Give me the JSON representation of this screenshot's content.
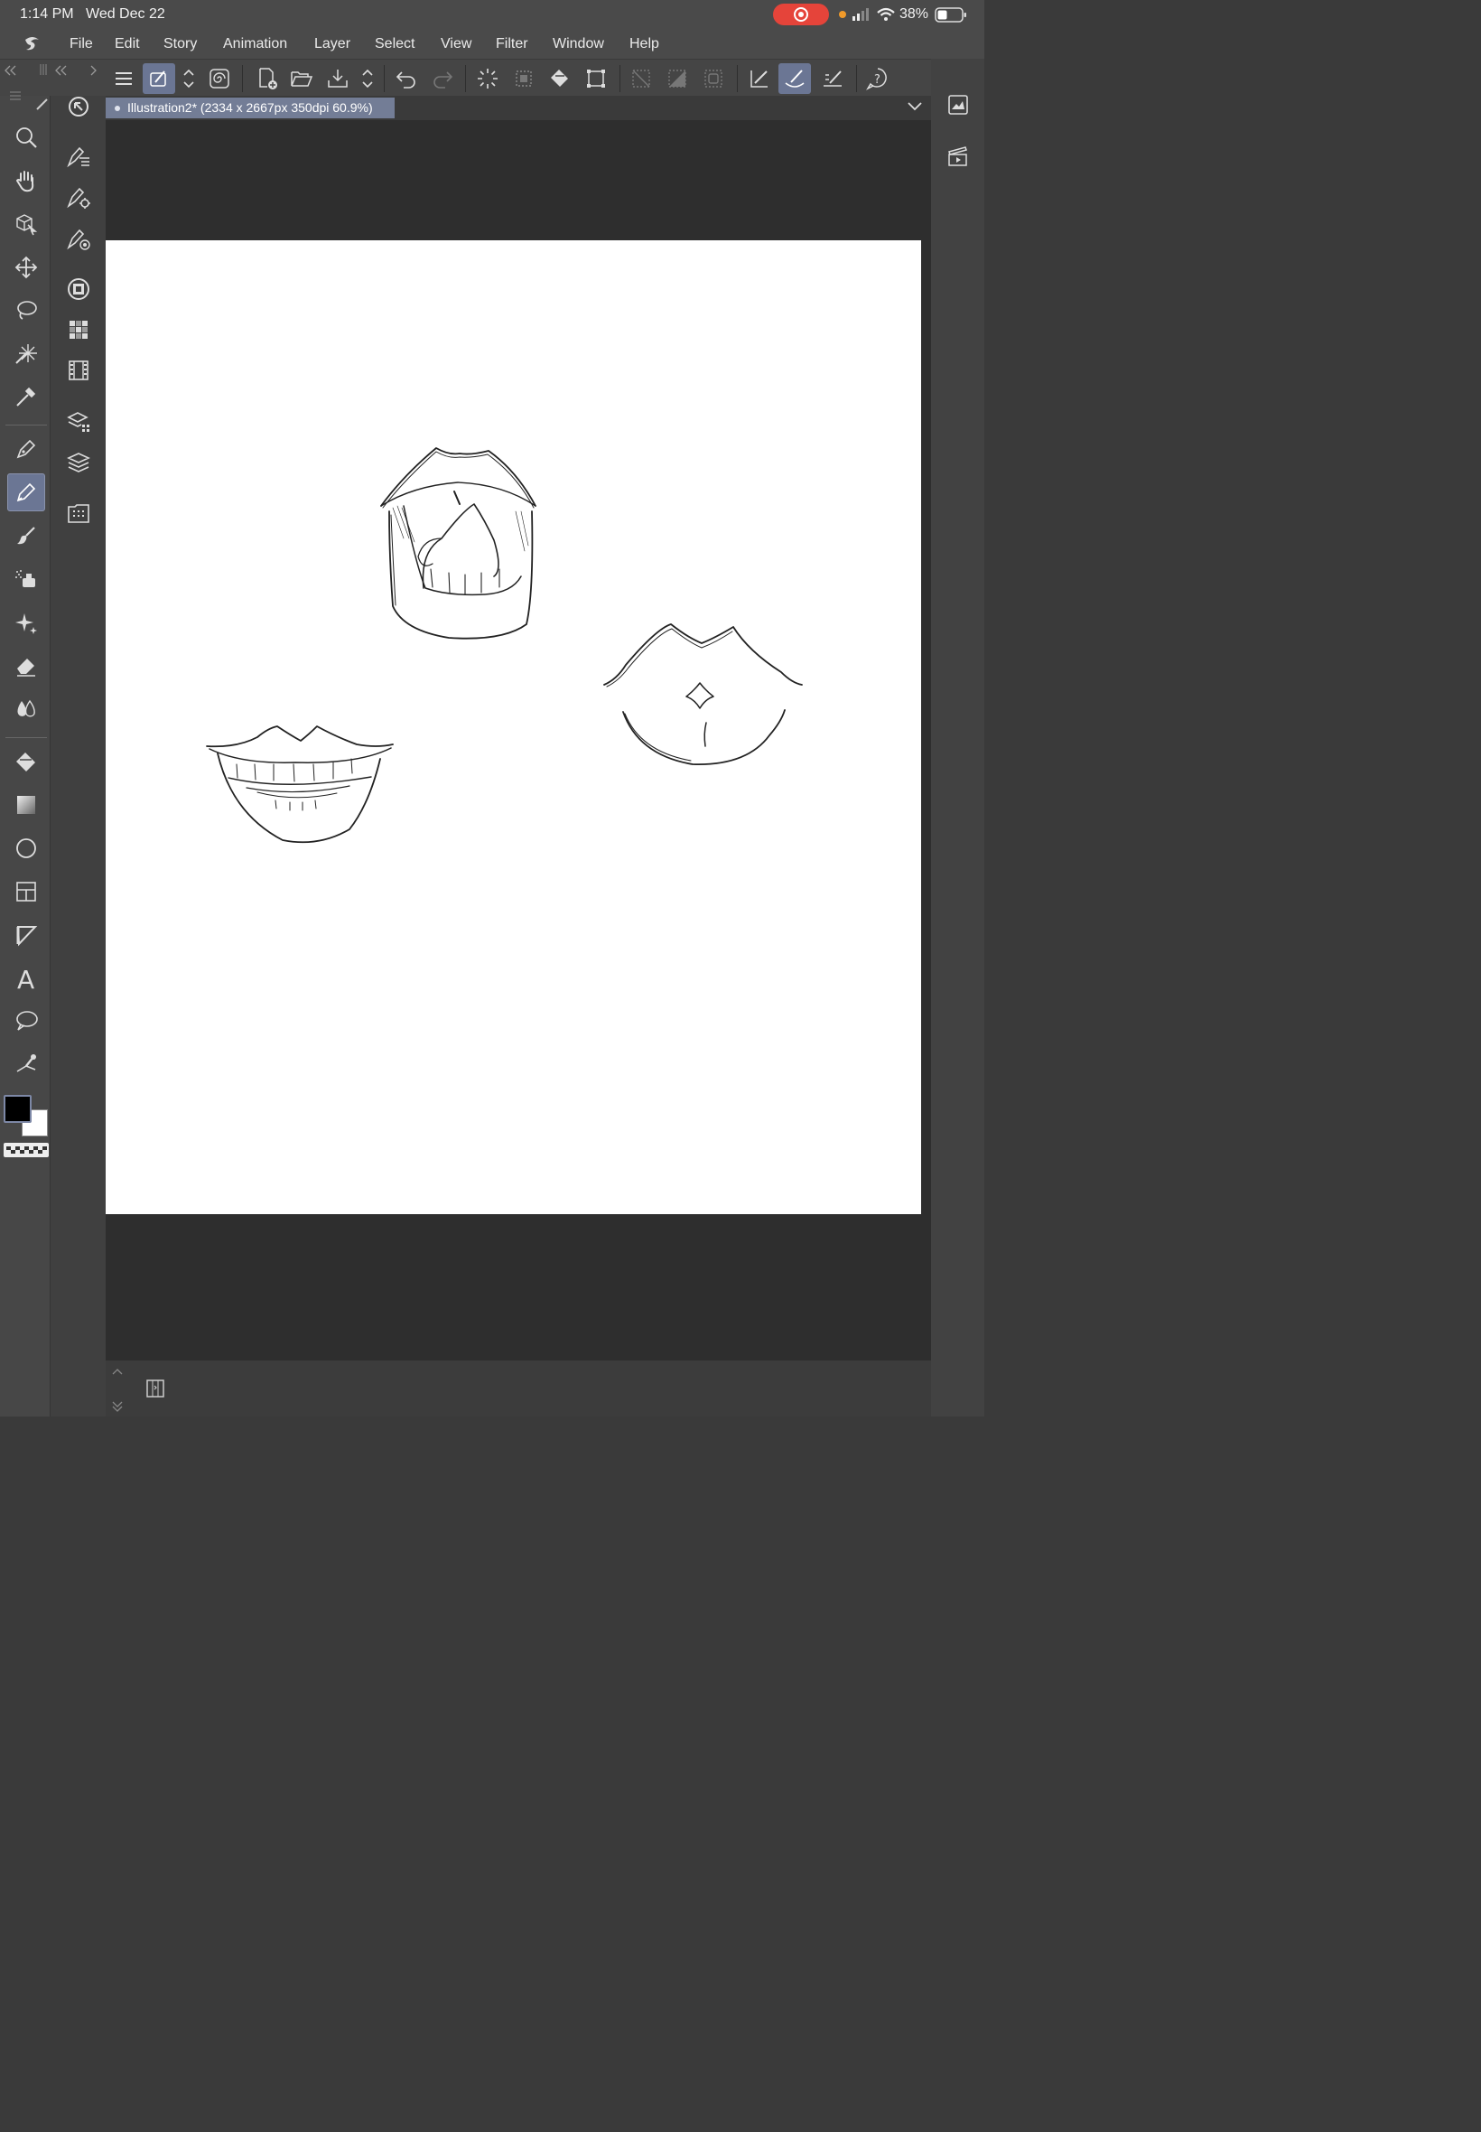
{
  "status_bar": {
    "time": "1:14 PM",
    "date": "Wed Dec 22",
    "battery": "38%"
  },
  "menu": {
    "items": [
      "File",
      "Edit",
      "Story",
      "Animation",
      "Layer",
      "Select",
      "View",
      "Filter",
      "Window",
      "Help"
    ]
  },
  "document_tab": {
    "title": "Illustration2* (2334 x 2667px 350dpi 60.9%)"
  },
  "colors": {
    "accent": "#6b7694",
    "canvas": "#ffffff",
    "workspace": "#2e2e2e",
    "main_color": "#000000",
    "sub_color": "#ffffff",
    "record": "#e5443a"
  },
  "tools": [
    "zoom-icon",
    "hand-icon",
    "operation-icon",
    "move-layer-icon",
    "lasso-selection-icon",
    "auto-select-icon",
    "eyedropper-icon",
    "pen-icon",
    "pencil-icon",
    "brush-icon",
    "airbrush-icon",
    "decoration-icon",
    "eraser-icon",
    "blend-icon",
    "fill-icon",
    "gradient-icon",
    "figure-icon",
    "frame-border-icon",
    "ruler-icon",
    "text-icon",
    "balloon-icon",
    "correct-line-icon"
  ],
  "subtools": [
    "sub-tool-icon",
    "tool-property-icon",
    "brush-size-icon",
    "color-wheel-icon",
    "color-set-icon",
    "timeline-icon",
    "layer-property-icon",
    "layer-icon",
    "material-icon"
  ]
}
